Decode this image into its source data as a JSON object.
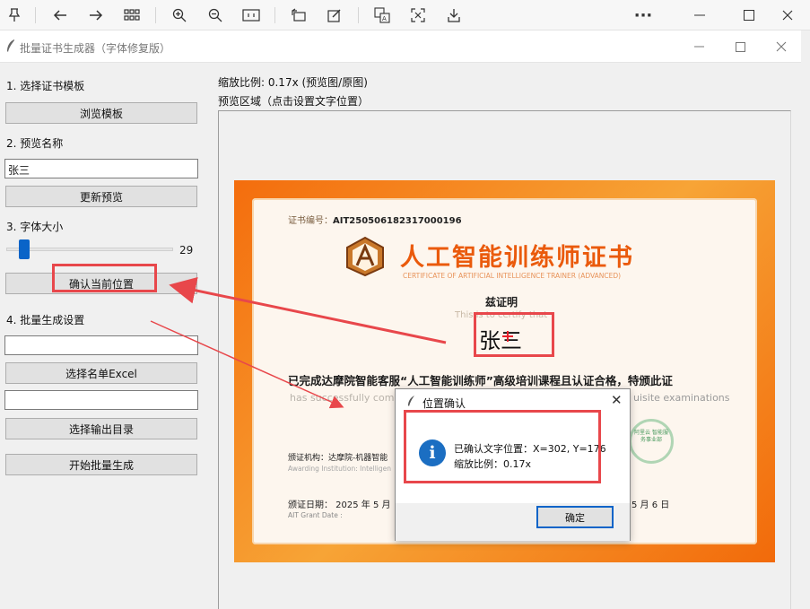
{
  "viewer": {
    "icons": [
      "pin-icon",
      "back-arrow-icon",
      "forward-arrow-icon",
      "grid-icon",
      "zoom-in-icon",
      "zoom-out-icon",
      "fit-width-icon",
      "rotate-icon",
      "edit-icon",
      "translate-icon",
      "crop-icon",
      "download-icon",
      "more-icon",
      "minimize-icon",
      "maximize-icon",
      "close-icon"
    ]
  },
  "app": {
    "title": "批量证书生成器（字体修复版）"
  },
  "left": {
    "section1": "1. 选择证书模板",
    "browse_btn": "浏览模板",
    "section2": "2. 预览名称",
    "name_value": "张三",
    "update_btn": "更新预览",
    "section3": "3. 字体大小",
    "font_size": "29",
    "confirm_btn": "确认当前位置",
    "section4": "4. 批量生成设置",
    "excel_path": "",
    "select_excel_btn": "选择名单Excel",
    "output_path": "",
    "select_output_btn": "选择输出目录",
    "start_btn": "开始批量生成"
  },
  "right": {
    "scale_text": "缩放比例: 0.17x (预览图/原图)",
    "preview_label": "预览区域（点击设置文字位置）"
  },
  "certificate": {
    "number_label": "证书编号：",
    "number": "AIT2505061823170001​96",
    "title": "人工智能训练师证书",
    "subtitle": "CERTIFICATE OF ARTIFICIAL INTELLIGENCE TRAINER (ADVANCED)",
    "zhengming": "兹证明",
    "this_is": "This is to certify that",
    "name": "张三",
    "body": "已完成达摩院智能客服“人工智能训练师”高级培训课程且认证合格，特颁此证",
    "has_text": "has successfully com",
    "exams_text": "uisite examinations",
    "issuer": "颁证机构：达摩院-机器智能",
    "issuer_en": "Awarding Institution: Intelligen",
    "date": "颁证日期：    2025 年  5  月",
    "date_en": "AIT Grant Date :",
    "date2": "5 月 6 日",
    "seal": "阿里云 智能服务事业部"
  },
  "dialog": {
    "title": "位置确认",
    "line1": "已确认文字位置：X=302, Y=176",
    "line2": "缩放比例：0.17x",
    "ok": "确定"
  },
  "colors": {
    "highlight": "#e8474b",
    "accent": "#0a64c8",
    "cert_orange": "#f46d0d"
  }
}
